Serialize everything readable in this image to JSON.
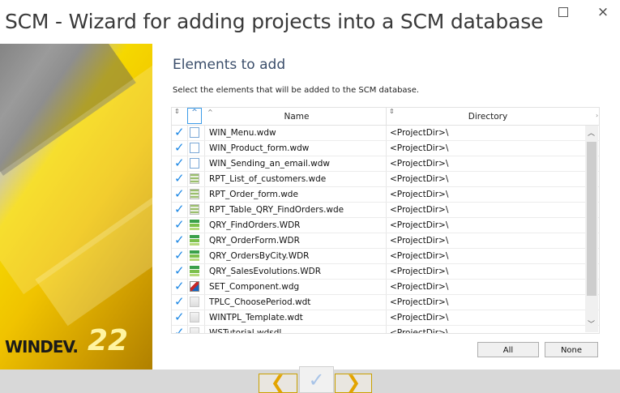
{
  "window": {
    "title": "SCM - Wizard for adding projects into a SCM database",
    "maximize_icon": "maximize-icon",
    "close_label": "×"
  },
  "sidebar": {
    "logo_text": "WINDEV.",
    "logo_version": "22"
  },
  "page": {
    "heading": "Elements to add",
    "description": "Select the elements that will be added to the SCM database."
  },
  "table": {
    "columns": {
      "name": "Name",
      "directory": "Directory"
    },
    "rows": [
      {
        "checked": true,
        "icon": "window-icon",
        "name": "WIN_Menu.wdw",
        "directory": "<ProjectDir>\\"
      },
      {
        "checked": true,
        "icon": "window-icon",
        "name": "WIN_Product_form.wdw",
        "directory": "<ProjectDir>\\"
      },
      {
        "checked": true,
        "icon": "window-icon",
        "name": "WIN_Sending_an_email.wdw",
        "directory": "<ProjectDir>\\"
      },
      {
        "checked": true,
        "icon": "report-icon",
        "name": "RPT_List_of_customers.wde",
        "directory": "<ProjectDir>\\"
      },
      {
        "checked": true,
        "icon": "report-icon",
        "name": "RPT_Order_form.wde",
        "directory": "<ProjectDir>\\"
      },
      {
        "checked": true,
        "icon": "report-icon",
        "name": "RPT_Table_QRY_FindOrders.wde",
        "directory": "<ProjectDir>\\"
      },
      {
        "checked": true,
        "icon": "query-icon",
        "name": "QRY_FindOrders.WDR",
        "directory": "<ProjectDir>\\"
      },
      {
        "checked": true,
        "icon": "query-icon",
        "name": "QRY_OrderForm.WDR",
        "directory": "<ProjectDir>\\"
      },
      {
        "checked": true,
        "icon": "query-icon",
        "name": "QRY_OrdersByCity.WDR",
        "directory": "<ProjectDir>\\"
      },
      {
        "checked": true,
        "icon": "query-icon",
        "name": "QRY_SalesEvolutions.WDR",
        "directory": "<ProjectDir>\\"
      },
      {
        "checked": true,
        "icon": "component-icon",
        "name": "SET_Component.wdg",
        "directory": "<ProjectDir>\\"
      },
      {
        "checked": true,
        "icon": "template-icon",
        "name": "TPLC_ChoosePeriod.wdt",
        "directory": "<ProjectDir>\\"
      },
      {
        "checked": true,
        "icon": "template-icon",
        "name": "WINTPL_Template.wdt",
        "directory": "<ProjectDir>\\"
      },
      {
        "checked": true,
        "icon": "template-icon",
        "name": "WSTutorial.wdsdl",
        "directory": "<ProjectDir>\\"
      }
    ]
  },
  "buttons": {
    "all": "All",
    "none": "None"
  },
  "nav": {
    "prev": "❮",
    "finish": "✓",
    "next": "❯"
  },
  "colors": {
    "check": "#1e88e5",
    "accent": "#f0c300"
  }
}
